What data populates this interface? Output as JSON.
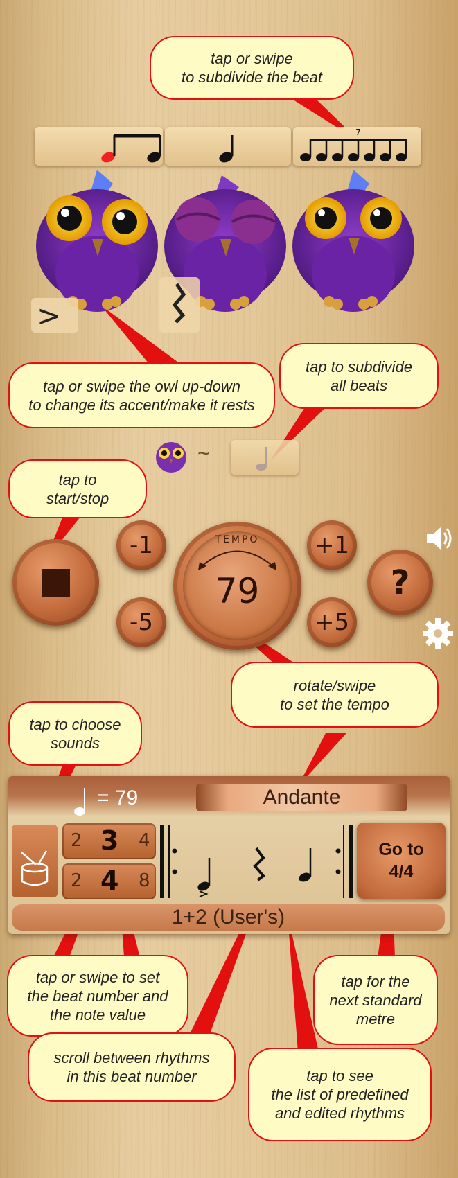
{
  "callouts": {
    "subdivide_beat": "tap or swipe\nto subdivide the beat",
    "owl_accent": "tap or swipe the owl up-down\nto change its accent/make it rests",
    "subdivide_all": "tap to subdivide\nall beats",
    "start_stop": "tap to\nstart/stop",
    "set_tempo": "rotate/swipe\nto set the tempo",
    "choose_sounds": "tap to choose\nsounds",
    "beat_number": "tap or swipe to set\nthe beat number and\nthe note value",
    "next_metre": "tap for the\nnext standard\nmetre",
    "scroll_rhythms": "scroll between rhythms\nin this beat number",
    "rhythm_list": "tap to see\nthe list of predefined\nand edited rhythms"
  },
  "subdivision_tuplet_label": "7",
  "controls": {
    "minus_1": "-1",
    "minus_5": "-5",
    "plus_1": "+1",
    "plus_5": "+5",
    "tempo_label": "TEMPO",
    "tempo_value": "79",
    "help": "?"
  },
  "bottom_panel": {
    "tempo_equals": "= 79",
    "tempo_marking": "Andante",
    "beats_options": [
      "2",
      "3",
      "4"
    ],
    "note_options": [
      "2",
      "4",
      "8"
    ],
    "go_to_button": "Go to\n4/4",
    "rhythm_name": "1+2 (User's)"
  },
  "icons": [
    "stop-icon",
    "speaker-icon",
    "gear-icon",
    "drum-icon",
    "owl-icon",
    "quarter-note-icon"
  ],
  "colors": {
    "callout_fill": "#fffbc4",
    "callout_border": "#e31010",
    "owl_purple": "#7a2fb0",
    "wood_button": "#c26a3c"
  }
}
